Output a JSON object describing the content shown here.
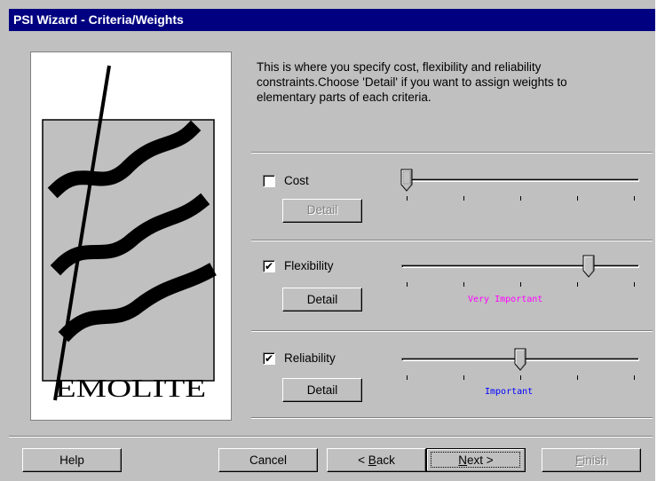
{
  "window": {
    "title": "PSI Wizard - Criteria/Weights"
  },
  "logo": {
    "text": "EMOLITE"
  },
  "description": "This is where you specify cost, flexibility and reliability constraints.Choose 'Detail' if you want to assign weights to elementary parts of each criteria.",
  "criteria": [
    {
      "label": "Cost",
      "checked": false,
      "checkmark": "",
      "detail_label": "Detail",
      "detail_enabled": false,
      "slider_position": 0,
      "slider_label": "",
      "slider_label_color": ""
    },
    {
      "label": "Flexibility",
      "checked": true,
      "checkmark": "✔",
      "detail_label": "Detail",
      "detail_enabled": true,
      "slider_position": 0.8,
      "slider_label": "Very Important",
      "slider_label_color": "#ff00ff"
    },
    {
      "label": "Reliability",
      "checked": true,
      "checkmark": "✔",
      "detail_label": "Detail",
      "detail_enabled": true,
      "slider_position": 0.5,
      "slider_label": "Important",
      "slider_label_color": "#0000ff"
    }
  ],
  "footer": {
    "help": "Help",
    "cancel": "Cancel",
    "back_prefix": "< ",
    "back_mnemonic": "B",
    "back_rest": "ack",
    "next_mnemonic": "N",
    "next_rest": "ext >",
    "finish_mnemonic": "F",
    "finish_rest": "inish"
  }
}
